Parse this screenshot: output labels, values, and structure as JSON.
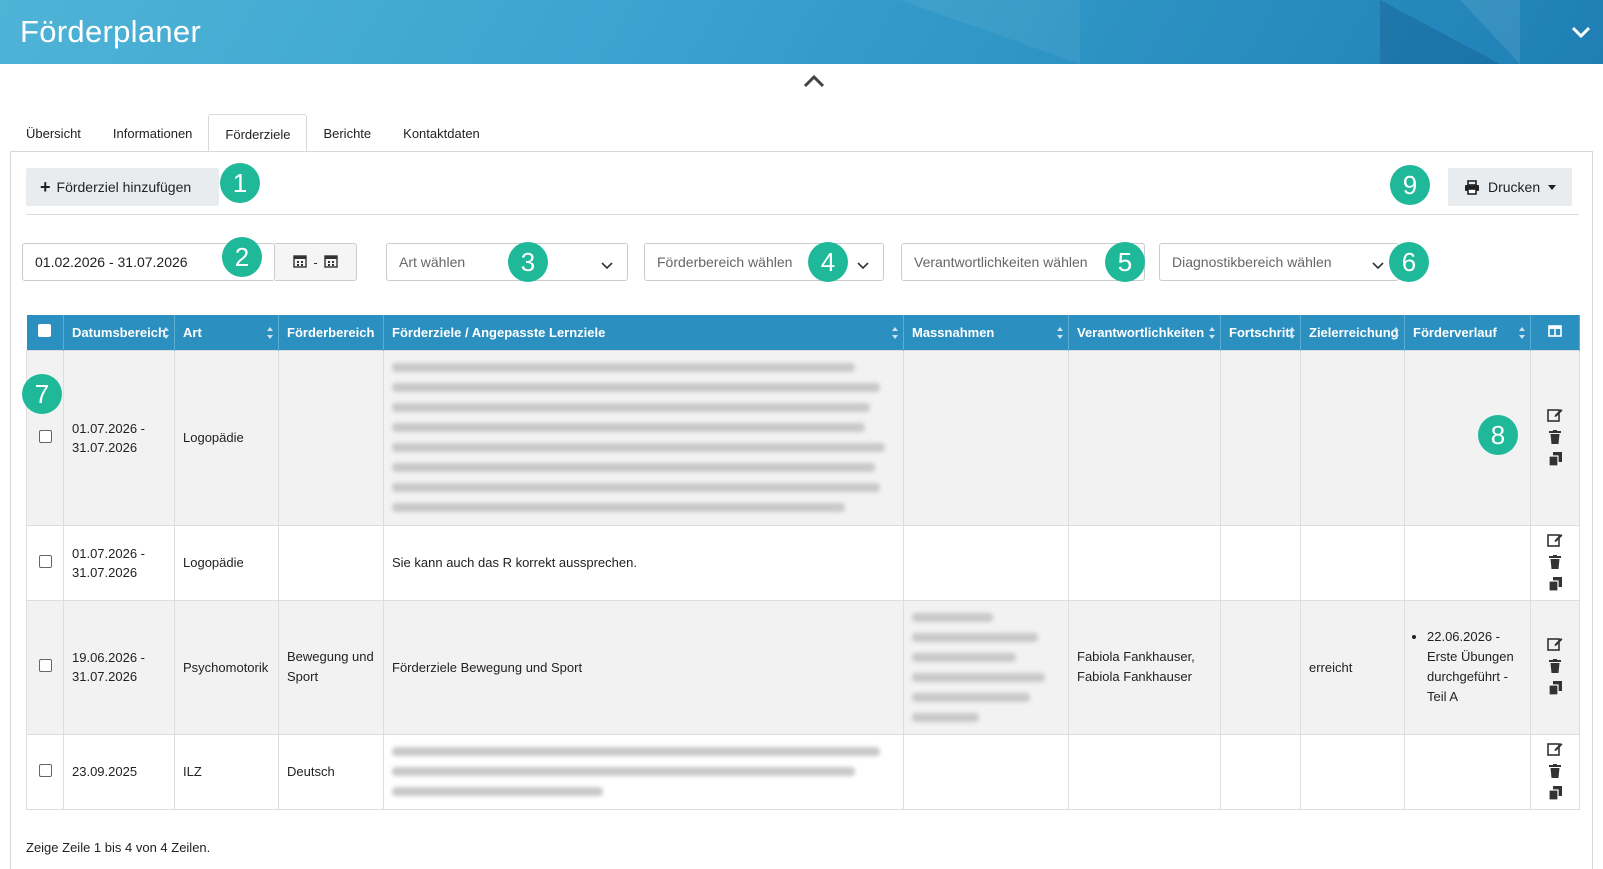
{
  "header": {
    "title": "Förderplaner",
    "collapse_icon": "chevron-down-icon",
    "collapse_up_icon": "chevron-up-icon"
  },
  "tabs": [
    {
      "label": "Übersicht",
      "active": false
    },
    {
      "label": "Informationen",
      "active": false
    },
    {
      "label": "Förderziele",
      "active": true
    },
    {
      "label": "Berichte",
      "active": false
    },
    {
      "label": "Kontaktdaten",
      "active": false
    }
  ],
  "toolbar": {
    "add_label": "Förderziel hinzufügen",
    "print_label": "Drucken"
  },
  "filters": {
    "date_range": "01.02.2026 - 31.07.2026",
    "art_placeholder": "Art wählen",
    "foerderbereich_placeholder": "Förderbereich wählen",
    "verantwortlichkeiten_placeholder": "Verantwortlichkeiten wählen",
    "diagnostik_placeholder": "Diagnostikbereich wählen"
  },
  "badges": [
    "1",
    "2",
    "3",
    "4",
    "5",
    "6",
    "7",
    "8",
    "9"
  ],
  "table": {
    "columns": [
      "Datumsbereich",
      "Art",
      "Förderbereich",
      "Förderziele / Angepasste Lernziele",
      "Massnahmen",
      "Verantwortlichkeiten",
      "Fortschritt",
      "Zielerreichung",
      "Förderverlauf"
    ],
    "rows": [
      {
        "date_from": "01.07.2026 -",
        "date_to": "31.07.2026",
        "art": "Logopädie",
        "foerderbereich": "",
        "ziele": "",
        "massnahmen": "",
        "verantwortlich": "",
        "fortschritt": "",
        "zielerreichung": "",
        "verlauf": []
      },
      {
        "date_from": "01.07.2026 -",
        "date_to": "31.07.2026",
        "art": "Logopädie",
        "foerderbereich": "",
        "ziele": "Sie kann auch das R korrekt aussprechen.",
        "massnahmen": "",
        "verantwortlich": "",
        "fortschritt": "",
        "zielerreichung": "",
        "verlauf": []
      },
      {
        "date_from": "19.06.2026 -",
        "date_to": "31.07.2026",
        "art": "Psychomotorik",
        "foerderbereich": "Bewegung und Sport",
        "ziele": "Förderziele Bewegung und Sport",
        "massnahmen": "",
        "verantwortlich": "Fabiola Fankhauser, Fabiola Fankhauser",
        "fortschritt": "",
        "zielerreichung": "erreicht",
        "verlauf": [
          "22.06.2026 - Erste Übungen durchgeführt - Teil A"
        ]
      },
      {
        "date_from": "23.09.2025",
        "date_to": "",
        "art": "ILZ",
        "foerderbereich": "Deutsch",
        "ziele": "",
        "massnahmen": "",
        "verantwortlich": "",
        "fortschritt": "",
        "zielerreichung": "",
        "verlauf": []
      }
    ]
  },
  "footer": {
    "info": "Zeige Zeile 1 bis 4 von 4 Zeilen."
  },
  "colors": {
    "header_blue": "#3aa3cf",
    "table_head": "#2b8fbf",
    "badge_green": "#1fb99a"
  }
}
